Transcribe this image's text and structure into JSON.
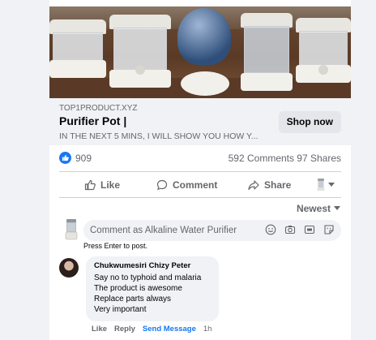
{
  "ad": {
    "domain": "TOP1PRODUCT.XYZ",
    "title": "Purifier Pot |",
    "description": "IN THE NEXT 5 MINS, I WILL SHOW YOU HOW Y...",
    "cta_label": "Shop now"
  },
  "stats": {
    "reactions": "909",
    "comments": "592 Comments",
    "shares": "97 Shares"
  },
  "actions": {
    "like": "Like",
    "comment": "Comment",
    "share": "Share"
  },
  "sort": {
    "label": "Newest"
  },
  "composer": {
    "placeholder": "Comment as Alkaline Water Purifier",
    "hint": "Press Enter to post."
  },
  "comments": [
    {
      "author": "Chukwumesiri Chizy Peter",
      "lines": [
        "Say no to typhoid and malaria",
        "The product is awesome",
        "Replace parts always",
        "Very important"
      ],
      "like": "Like",
      "reply": "Reply",
      "send": "Send Message",
      "time": "1h"
    }
  ],
  "colors": {
    "accent": "#1877f2",
    "muted_text": "#65676b",
    "surface": "#f0f2f5"
  }
}
